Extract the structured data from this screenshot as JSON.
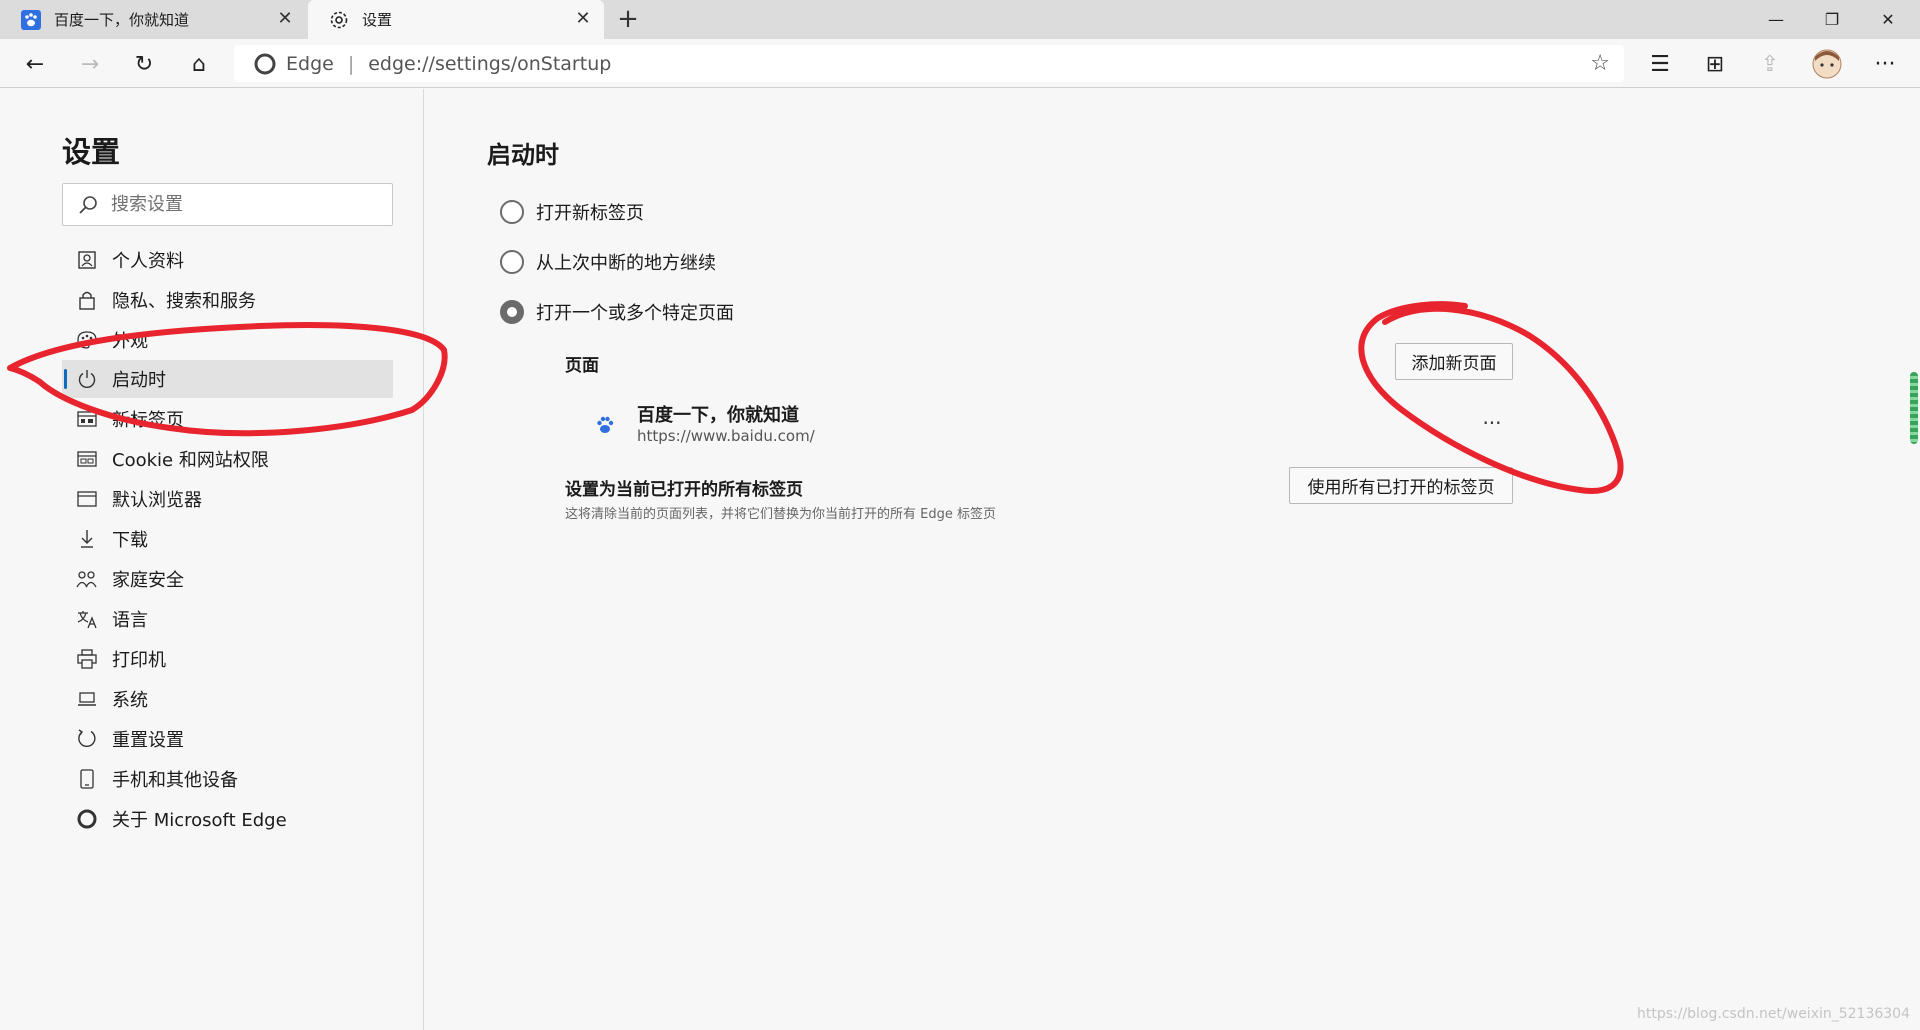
{
  "tabs": [
    {
      "title": "百度一下，你就知道",
      "close": "✕"
    },
    {
      "title": "设置",
      "close": "✕"
    }
  ],
  "newtab": "+",
  "window": {
    "minimize": "—",
    "restore": "❐",
    "close": "✕"
  },
  "toolbar": {
    "back": "←",
    "forward": "→",
    "refresh": "↻",
    "home": "⌂",
    "favorites": "☆",
    "favorites_list": "☰",
    "collections": "⊞",
    "share": "⇪",
    "more": "···"
  },
  "address": {
    "brand": "Edge",
    "separator": "|",
    "url": "edge://settings/onStartup",
    "star": "☆"
  },
  "sidebar": {
    "title": "设置",
    "search_placeholder": "搜索设置",
    "items": [
      {
        "label": "个人资料",
        "icon": "profile-icon"
      },
      {
        "label": "隐私、搜索和服务",
        "icon": "lock-icon"
      },
      {
        "label": "外观",
        "icon": "palette-icon"
      },
      {
        "label": "启动时",
        "icon": "power-icon"
      },
      {
        "label": "新标签页",
        "icon": "newtab-icon"
      },
      {
        "label": "Cookie 和网站权限",
        "icon": "cookie-icon"
      },
      {
        "label": "默认浏览器",
        "icon": "browser-icon"
      },
      {
        "label": "下载",
        "icon": "download-icon"
      },
      {
        "label": "家庭安全",
        "icon": "family-icon"
      },
      {
        "label": "语言",
        "icon": "language-icon"
      },
      {
        "label": "打印机",
        "icon": "printer-icon"
      },
      {
        "label": "系统",
        "icon": "system-icon"
      },
      {
        "label": "重置设置",
        "icon": "reset-icon"
      },
      {
        "label": "手机和其他设备",
        "icon": "phone-icon"
      },
      {
        "label": "关于 Microsoft Edge",
        "icon": "edge-logo-icon"
      }
    ],
    "active_index": 3
  },
  "main": {
    "title": "启动时",
    "options": [
      {
        "label": "打开新标签页",
        "checked": false
      },
      {
        "label": "从上次中断的地方继续",
        "checked": false
      },
      {
        "label": "打开一个或多个特定页面",
        "checked": true
      }
    ],
    "pages_label": "页面",
    "add_page": "添加新页面",
    "page": {
      "title": "百度一下，你就知道",
      "url": "https://www.baidu.com/",
      "more": "···"
    },
    "use_open_title": "设置为当前已打开的所有标签页",
    "use_open_desc": "这将清除当前的页面列表，并将它们替换为你当前打开的所有 Edge 标签页",
    "use_open_button": "使用所有已打开的标签页"
  },
  "watermark": "https://blog.csdn.net/weixin_52136304",
  "colors": {
    "accent": "#0f6cbd",
    "annotation": "#e8242e"
  }
}
